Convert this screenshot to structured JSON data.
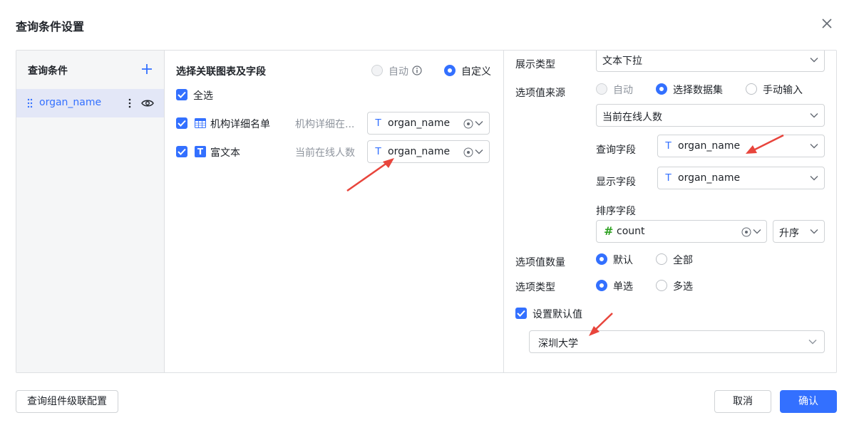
{
  "dialog": {
    "title": "查询条件设置"
  },
  "left": {
    "header": "查询条件",
    "items": [
      {
        "label": "organ_name"
      }
    ]
  },
  "middle": {
    "header": "选择关联图表及字段",
    "mode_auto": "自动",
    "mode_custom": "自定义",
    "select_all": "全选",
    "rows": [
      {
        "chart_name": "机构详细名单",
        "dataset": "机构详细在...",
        "field": "organ_name"
      },
      {
        "chart_name": "富文本",
        "dataset": "当前在线人数",
        "field": "organ_name"
      }
    ]
  },
  "right": {
    "display_type_label": "展示类型",
    "display_type_value": "文本下拉",
    "source_label": "选项值来源",
    "source_options": [
      "自动",
      "选择数据集",
      "手动输入"
    ],
    "dataset_value": "当前在线人数",
    "query_field_label": "查询字段",
    "query_field_value": "organ_name",
    "display_field_label": "显示字段",
    "display_field_value": "organ_name",
    "sort_field_label": "排序字段",
    "sort_field_value": "count",
    "sort_order_value": "升序",
    "count_label": "选项值数量",
    "count_options": [
      "默认",
      "全部"
    ],
    "type_label": "选项类型",
    "type_options": [
      "单选",
      "多选"
    ],
    "default_label": "设置默认值",
    "default_value": "深圳大学"
  },
  "footer": {
    "cascade_button": "查询组件级联配置",
    "cancel_button": "取消",
    "confirm_button": "确认"
  },
  "colors": {
    "accent": "#3370ff",
    "annotation": "#e8453c",
    "number_icon": "#2ea121"
  },
  "icons": [
    "close-icon",
    "plus-icon",
    "drag-handle-icon",
    "more-vertical-icon",
    "eye-icon",
    "info-icon",
    "table-icon",
    "text-icon",
    "field-type-text-icon",
    "field-type-number-icon",
    "clear-icon",
    "chevron-down-icon",
    "annotation-arrow-icon"
  ]
}
